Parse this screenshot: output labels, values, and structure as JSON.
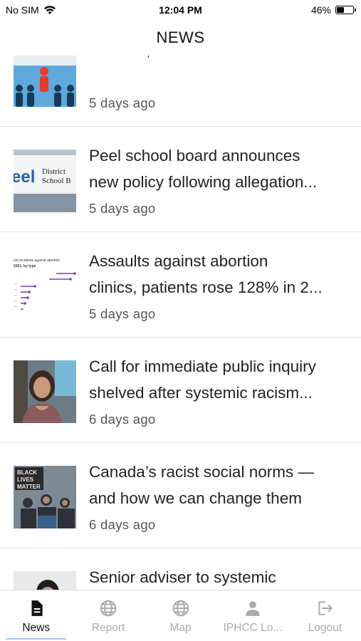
{
  "status_bar": {
    "carrier": "No SIM",
    "time": "12:04 PM",
    "battery_percent": "46%",
    "battery_level": 0.46
  },
  "header": {
    "title": "NEWS"
  },
  "news_items": [
    {
      "title_lines": [
        "RACIST, SEXIST"
      ],
      "time": "5 days ago",
      "thumbnail": "people-icons-image"
    },
    {
      "title_lines": [
        "Peel school board announces",
        "new policy following allegation..."
      ],
      "time": "5 days ago",
      "thumbnail": "peel-district-sign-image",
      "thumbnail_text": {
        "brand": "eel",
        "line1": "District",
        "line2": "School B"
      }
    },
    {
      "title_lines": [
        "Assaults against abortion",
        "clinics, patients rose 128% in 2..."
      ],
      "time": "5 days ago",
      "thumbnail": "chart-image",
      "thumbnail_text": {
        "line1": "ent incidents against abortion",
        "line2": "2021, by type"
      }
    },
    {
      "title_lines": [
        "Call for immediate public inquiry",
        "shelved after systemic racism..."
      ],
      "time": "6 days ago",
      "thumbnail": "woman-portrait-image"
    },
    {
      "title_lines": [
        "Canada’s racist social norms —",
        "and how we can change them"
      ],
      "time": "6 days ago",
      "thumbnail": "protest-crowd-image",
      "thumbnail_text": {
        "line1": "BLACK",
        "line2": "LIVES",
        "line3": "MATTER"
      }
    },
    {
      "title_lines": [
        "Senior adviser to systemic"
      ],
      "time": "",
      "thumbnail": "man-portrait-image"
    }
  ],
  "tabs": [
    {
      "label": "News",
      "icon": "document-icon",
      "active": true
    },
    {
      "label": "Report",
      "icon": "globe-icon",
      "active": false
    },
    {
      "label": "Map",
      "icon": "globe-icon",
      "active": false
    },
    {
      "label": "IPHCC Lo...",
      "icon": "person-icon",
      "active": false
    },
    {
      "label": "Logout",
      "icon": "logout-icon",
      "active": false
    }
  ],
  "colors": {
    "active_tab": "#111111",
    "inactive_tab": "#aaaaaa",
    "tab_indicator": "#a9c8ec",
    "divider": "#e6e6e6"
  }
}
